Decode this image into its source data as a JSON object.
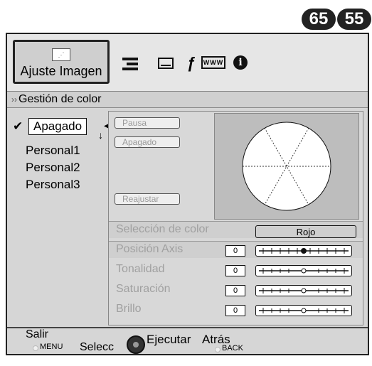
{
  "badges": [
    "65",
    "55"
  ],
  "toolbar": {
    "ajuste_label": "Ajuste Imagen",
    "icons": [
      "picture-icon",
      "list-icon",
      "screen-icon",
      "wrench-icon",
      "www-icon",
      "info-icon"
    ],
    "www_text": "WWW",
    "info_text": "i"
  },
  "section": {
    "title": "Gestión de color",
    "chevron": "››"
  },
  "options": {
    "selected": "Apagado",
    "items": [
      "Personal1",
      "Personal2",
      "Personal3"
    ]
  },
  "buttons": {
    "pausa": "Pausa",
    "apagado": "Apagado",
    "reajustar": "Reajustar"
  },
  "settings": {
    "seleccion_label": "Selección de color",
    "seleccion_value": "Rojo",
    "posicion_label": "Posición Axis",
    "posicion_value": "0",
    "tonalidad_label": "Tonalidad",
    "tonalidad_value": "0",
    "saturacion_label": "Saturación",
    "saturacion_value": "0",
    "brillo_label": "Brillo",
    "brillo_value": "0"
  },
  "bottom": {
    "salir": "Salir",
    "menu": "MENU",
    "selecc": "Selecc",
    "ejecutar": "Ejecutar",
    "atras": "Atrás",
    "back": "BACK"
  },
  "colors": {
    "frame_bg": "#d6d6d6",
    "badge_bg": "#222222",
    "wheel_bg": "#bdbdbd"
  }
}
